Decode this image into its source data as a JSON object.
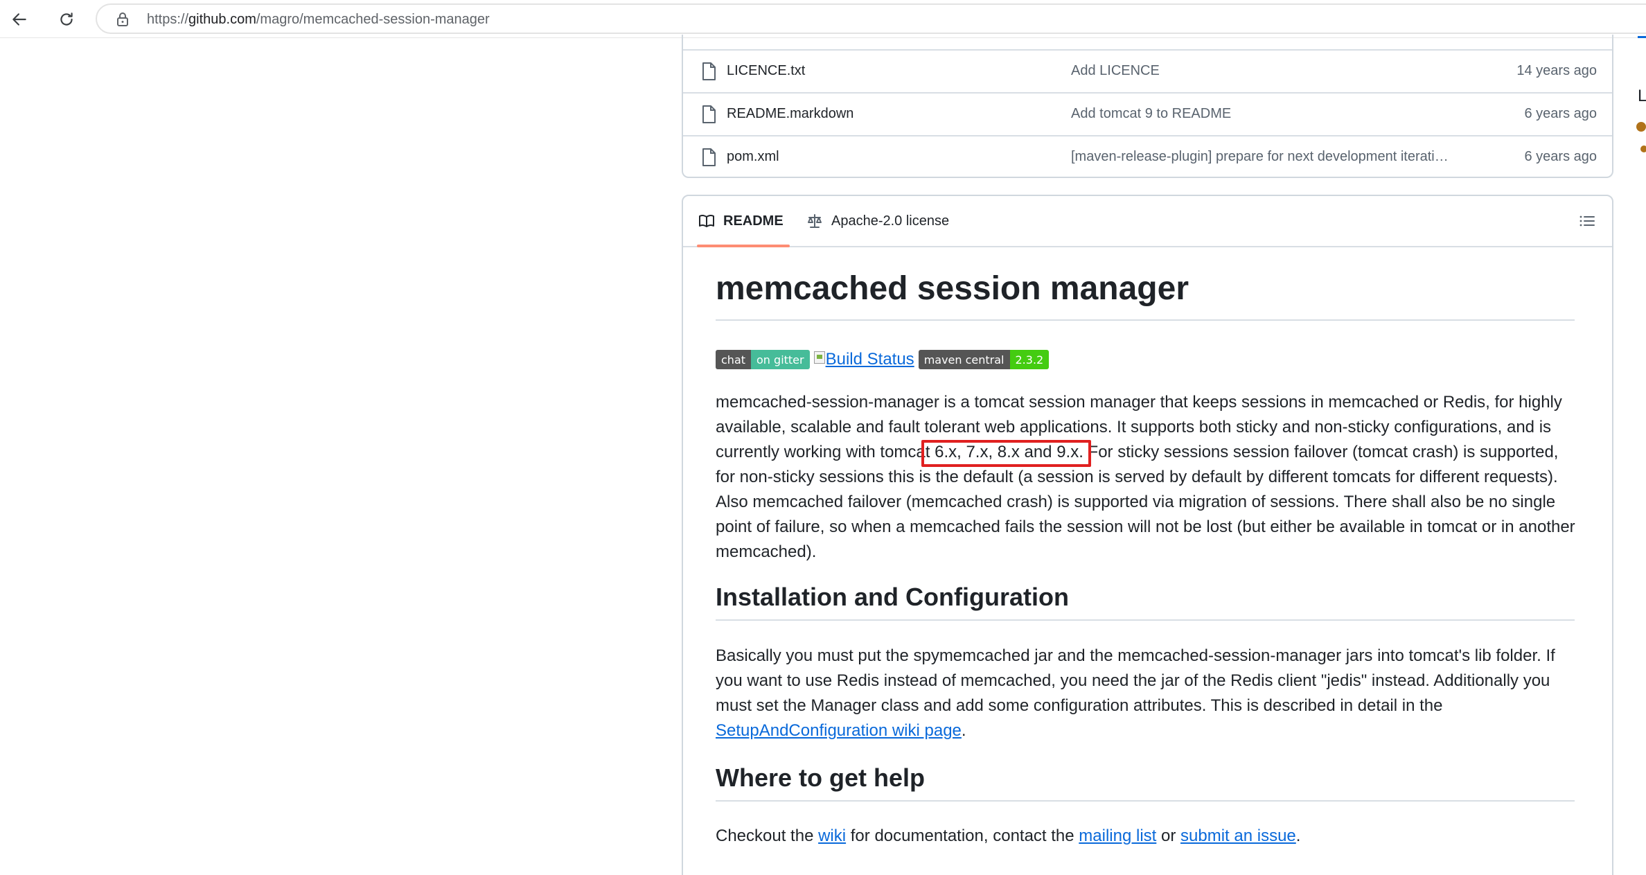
{
  "browser": {
    "url_scheme": "https://",
    "url_host": "github.com",
    "url_path": "/magro/memcached-session-manager"
  },
  "sidebar_edge": {
    "letter": "L"
  },
  "files": [
    {
      "name": "LICENCE.txt",
      "commit": "Add LICENCE",
      "time": "14 years ago"
    },
    {
      "name": "README.markdown",
      "commit": "Add tomcat 9 to README",
      "time": "6 years ago"
    },
    {
      "name": "pom.xml",
      "commit": "[maven-release-plugin] prepare for next development iterati…",
      "time": "6 years ago"
    }
  ],
  "readme": {
    "tabs": {
      "readme": "README",
      "license": "Apache-2.0 license"
    },
    "title": "memcached session manager",
    "badges": {
      "chat_label": "chat",
      "chat_value": "on gitter",
      "build_alt": "Build Status",
      "maven_label": "maven central",
      "maven_value": "2.3.2"
    },
    "intro": {
      "before_highlight": "memcached-session-manager is a tomcat session manager that keeps sessions in memcached or Redis, for highly available, scalable and fault tolerant web applications. It supports both sticky and non-sticky configurations, and is currently working with tomcat 6.x, 7.x, 8.x and 9.x. For sticky sessions session failover (tomcat crash) is supported, for non-sticky sessions this is the default (a session is served by default by different tomcats for different requests). Also memcached failover (memcached crash) is supported via migration of sessions. There shall also be no single point of failure, so when a memcached fails the session will not be lost (but either be available in tomcat or in another memcached)."
    },
    "install": {
      "heading": "Installation and Configuration",
      "text": "Basically you must put the spymemcached jar and the memcached-session-manager jars into tomcat's lib folder. If you want to use Redis instead of memcached, you need the jar of the Redis client \"jedis\" instead. Additionally you must set the Manager class and add some configuration attributes. This is described in detail in the ",
      "link": "SetupAndConfiguration wiki page",
      "after": "."
    },
    "help": {
      "heading": "Where to get help",
      "t1": "Checkout the ",
      "wiki": "wiki",
      "t2": " for documentation, contact the ",
      "mailing": "mailing list",
      "t3": " or ",
      "issue": "submit an issue",
      "t4": "."
    }
  },
  "colors": {
    "link": "#0969da",
    "highlight": "#e02020",
    "tab_underline": "#fd8c73"
  }
}
